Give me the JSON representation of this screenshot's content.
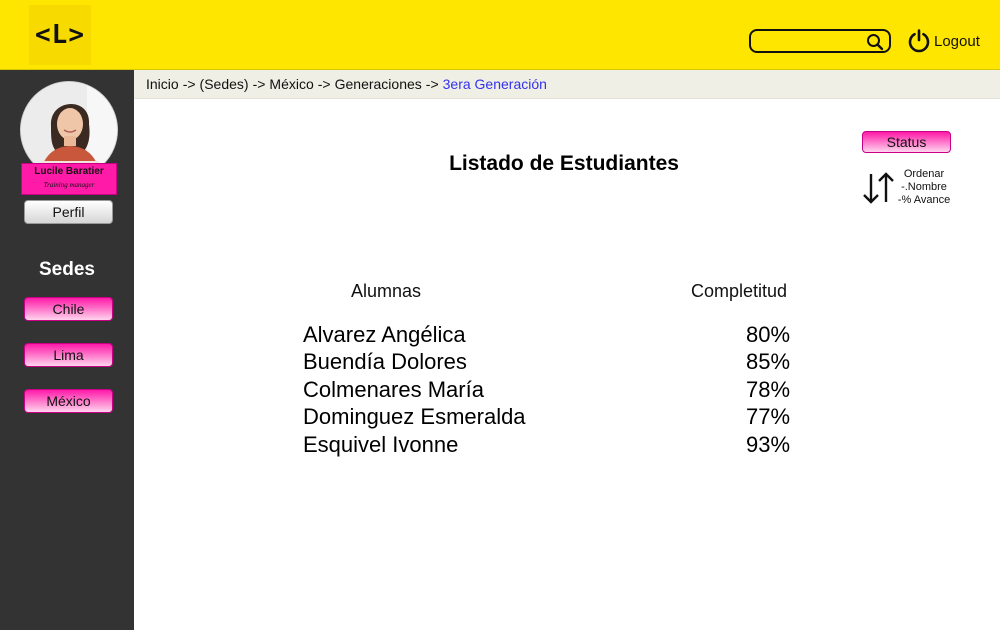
{
  "header": {
    "logo_text": "<L>",
    "search": {
      "placeholder": "",
      "value": ""
    },
    "logout_label": "Logout",
    "colors": {
      "background": "#ffe600"
    }
  },
  "sidebar": {
    "profile": {
      "name": "Lucile Baratier",
      "role": "Training manager"
    },
    "perfil_label": "Perfil",
    "sedes_title": "Sedes",
    "sedes": [
      {
        "label": "Chile"
      },
      {
        "label": "Lima"
      },
      {
        "label": "México"
      }
    ],
    "colors": {
      "background": "#333333",
      "accent": "#ff1aa8"
    }
  },
  "breadcrumb": {
    "items": [
      "Inicio",
      "(Sedes)",
      "México",
      "Generaciones"
    ],
    "separator": "->",
    "current": "3era Generación"
  },
  "main": {
    "title": "Listado de Estudiantes",
    "status_label": "Status",
    "sort": {
      "title": "Ordenar",
      "option_name": "-.Nombre",
      "option_progress": "-% Avance"
    },
    "columns": {
      "name": "Alumnas",
      "completion": "Completitud"
    },
    "students": [
      {
        "name": "Alvarez Angélica",
        "completion": "80%"
      },
      {
        "name": "Buendía Dolores",
        "completion": "85%"
      },
      {
        "name": "Colmenares María",
        "completion": "78%"
      },
      {
        "name": "Dominguez Esmeralda",
        "completion": "77%"
      },
      {
        "name": "Esquivel Ivonne",
        "completion": "93%"
      }
    ]
  }
}
